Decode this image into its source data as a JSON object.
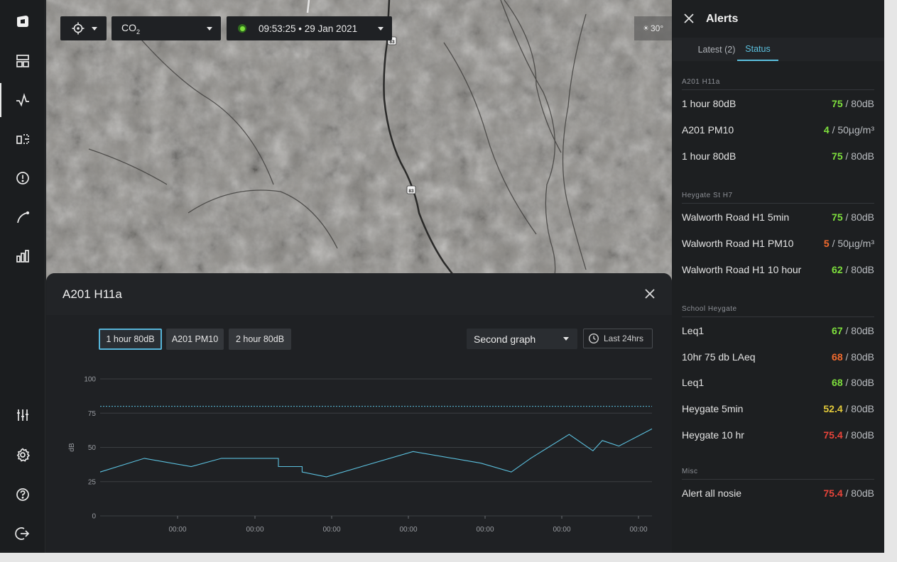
{
  "nav": {
    "items": [
      {
        "name": "logo-icon"
      },
      {
        "name": "dashboard-icon"
      },
      {
        "name": "activity-icon"
      },
      {
        "name": "devices-icon"
      },
      {
        "name": "alert-icon"
      },
      {
        "name": "route-icon"
      },
      {
        "name": "analytics-icon"
      },
      {
        "name": "filters-icon"
      },
      {
        "name": "settings-icon"
      },
      {
        "name": "help-icon"
      },
      {
        "name": "logout-icon"
      }
    ]
  },
  "map": {
    "pollutant_label": "CO",
    "pollutant_sub": "2",
    "datetime": "09:53:25 • 29 Jan 2021",
    "temperature": "30°",
    "road_label": "83"
  },
  "panel": {
    "title": "A201 H11a",
    "tabs": [
      "1 hour 80dB",
      "A201 PM10",
      "2 hour 80dB"
    ],
    "graph_select": "Second graph",
    "range_label": "Last 24hrs"
  },
  "chart_data": {
    "type": "line",
    "ylabel": "dB",
    "ylim": [
      0,
      100
    ],
    "yticks": [
      "0",
      "25",
      "50",
      "75",
      "100"
    ],
    "xticks": [
      "00:00",
      "00:00",
      "00:00",
      "00:00",
      "00:00",
      "00:00",
      "00:00",
      "00:00"
    ],
    "threshold": 80,
    "line_color": "#5bc0de",
    "series": [
      {
        "points": [
          [
            0,
            32
          ],
          [
            0.08,
            42
          ],
          [
            0.165,
            36
          ],
          [
            0.22,
            42
          ],
          [
            0.323,
            42
          ],
          [
            0.323,
            36
          ],
          [
            0.366,
            36
          ],
          [
            0.366,
            32
          ],
          [
            0.41,
            28.5
          ],
          [
            0.567,
            47
          ],
          [
            0.69,
            38.5
          ],
          [
            0.745,
            32
          ],
          [
            0.78,
            42
          ],
          [
            0.85,
            59.5
          ],
          [
            0.893,
            47.5
          ],
          [
            0.91,
            55
          ],
          [
            0.94,
            51
          ],
          [
            1,
            63.5
          ]
        ]
      }
    ]
  },
  "alerts": {
    "title": "Alerts",
    "tabs": [
      "Latest (2)",
      "Status"
    ],
    "groups": [
      {
        "title": "A201 H11a",
        "rows": [
          {
            "label": "1 hour 80dB",
            "value": "75",
            "limit": " / 80dB",
            "color": "#7ee03d"
          },
          {
            "label": "A201 PM10",
            "value": "4",
            "limit": " / 50µg/m³",
            "color": "#7ee03d"
          },
          {
            "label": "1 hour 80dB",
            "value": "75",
            "limit": " / 80dB",
            "color": "#7ee03d"
          }
        ]
      },
      {
        "title": "Heygate St H7",
        "rows": [
          {
            "label": "Walworth Road H1 5min",
            "value": "75",
            "limit": " / 80dB",
            "color": "#7ee03d"
          },
          {
            "label": "Walworth Road H1 PM10",
            "value": "5",
            "limit": " / 50µg/m³",
            "color": "#f36b2e"
          },
          {
            "label": "Walworth Road H1 10 hour",
            "value": "62",
            "limit": " / 80dB",
            "color": "#7ee03d"
          }
        ]
      },
      {
        "title": "School Heygate",
        "rows": [
          {
            "label": "Leq1",
            "value": "67",
            "limit": " / 80dB",
            "color": "#7ee03d"
          },
          {
            "label": "10hr 75 db LAeq",
            "value": "68",
            "limit": " / 80dB",
            "color": "#f36b2e"
          },
          {
            "label": "Leq1",
            "value": "68",
            "limit": " / 80dB",
            "color": "#7ee03d"
          },
          {
            "label": "Heygate 5min",
            "value": "52.4",
            "limit": " / 80dB",
            "color": "#e2c93a"
          },
          {
            "label": "Heygate 10 hr",
            "value": "75.4",
            "limit": " / 80dB",
            "color": "#e8443a"
          }
        ]
      },
      {
        "title": "Misc",
        "rows": [
          {
            "label": "Alert all nosie",
            "value": "75.4",
            "limit": " / 80dB",
            "color": "#e8443a"
          }
        ]
      }
    ]
  }
}
